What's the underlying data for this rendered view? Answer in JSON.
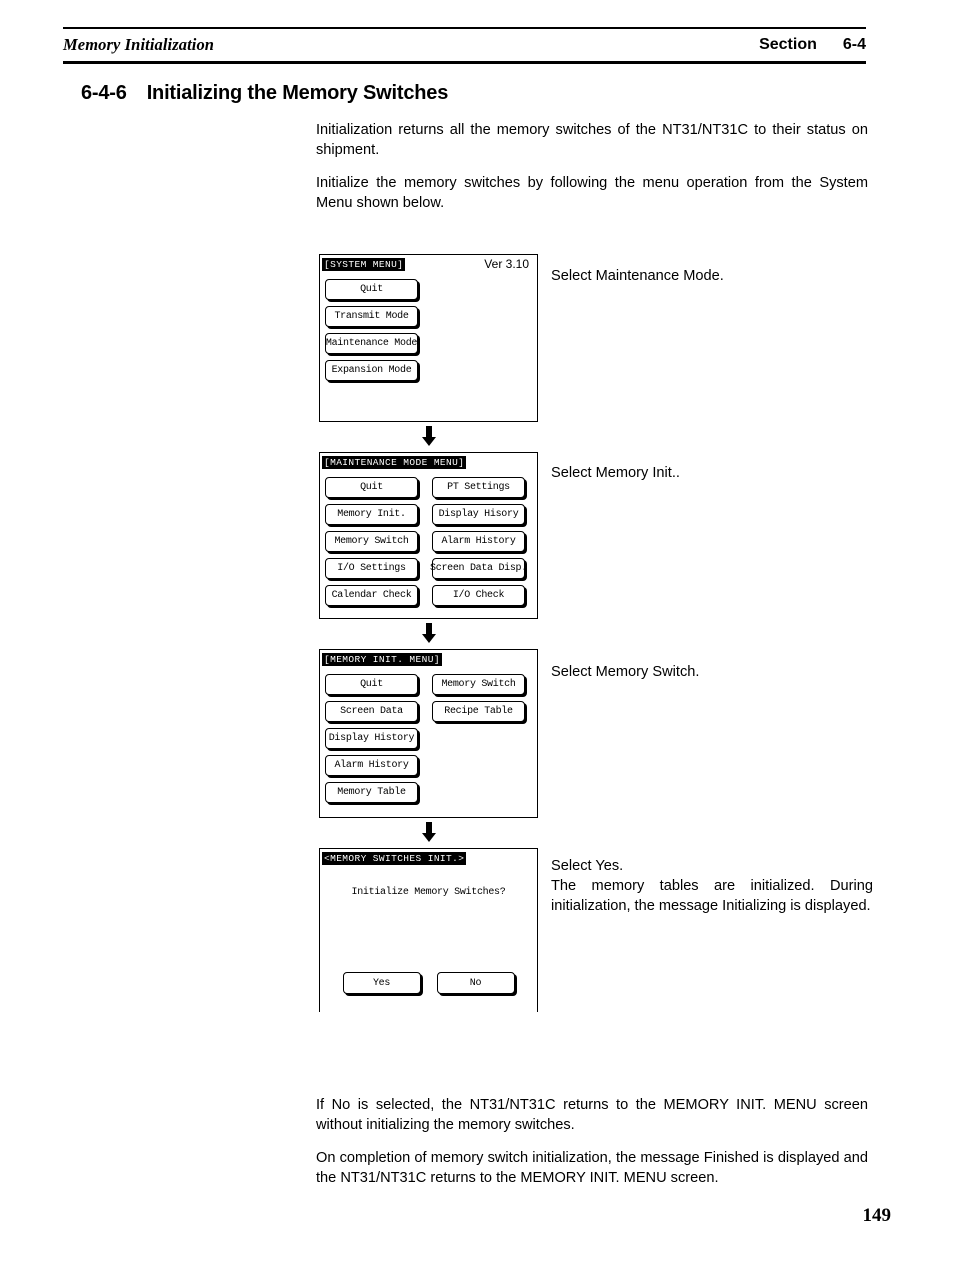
{
  "header": {
    "title": "Memory Initialization",
    "section_label": "Section",
    "section_number": "6-4"
  },
  "heading": {
    "number": "6-4-6",
    "title": "Initializing the Memory Switches"
  },
  "intro": {
    "paragraph1": "Initialization returns all the memory switches of the NT31/NT31C to their status on shipment.",
    "paragraph2": "Initialize the memory switches by following the menu operation from the System Menu shown below."
  },
  "flow": {
    "screens": [
      {
        "title": "[SYSTEM MENU]",
        "version": "Ver 3.10",
        "columns": [
          [
            "Quit",
            "Transmit Mode",
            "Maintenance Mode",
            "Expansion Mode"
          ]
        ],
        "annotation": [
          "Select Maintenance Mode."
        ]
      },
      {
        "title": "[MAINTENANCE MODE MENU]",
        "version": "",
        "columns": [
          [
            "Quit",
            "Memory Init.",
            "Memory Switch",
            "I/O Settings",
            "Calendar Check"
          ],
          [
            "PT Settings",
            "Display Hisory",
            "Alarm History",
            "Screen Data Disp.",
            "I/O Check"
          ]
        ],
        "annotation": [
          "Select Memory Init.."
        ]
      },
      {
        "title": "[MEMORY INIT. MENU]",
        "version": "",
        "columns": [
          [
            "Quit",
            "Screen Data",
            "Display History",
            "Alarm History",
            "Memory Table"
          ],
          [
            "Memory Switch",
            "Recipe Table"
          ]
        ],
        "annotation": [
          "Select Memory Switch."
        ]
      }
    ],
    "dialog": {
      "title": "<MEMORY SWITCHES INIT.>",
      "prompt": "Initialize Memory Switches?",
      "yes_label": "Yes",
      "no_label": "No",
      "annotation_line": "Select Yes.",
      "annotation_para": "The memory tables are initialized. During initialization, the message Initializing is displayed."
    }
  },
  "outro": {
    "paragraph1": "If No is selected, the NT31/NT31C returns to the MEMORY INIT. MENU screen without initializing the memory switches.",
    "paragraph2": "On completion of memory switch initialization, the message Finished is displayed and the NT31/NT31C returns to the MEMORY INIT. MENU screen."
  },
  "page_number": "149"
}
